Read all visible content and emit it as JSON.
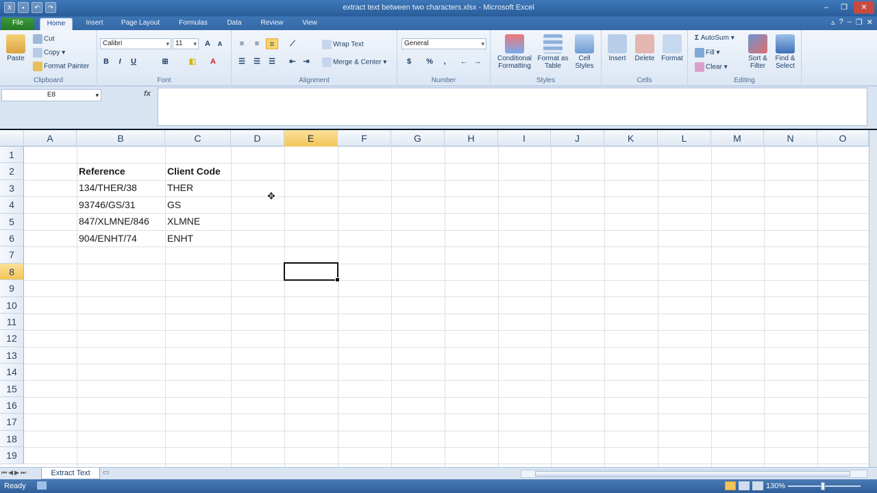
{
  "window": {
    "title": "extract text between two characters.xlsx - Microsoft Excel"
  },
  "tabs": [
    "File",
    "Home",
    "Insert",
    "Page Layout",
    "Formulas",
    "Data",
    "Review",
    "View"
  ],
  "ribbon": {
    "clipboard": {
      "paste": "Paste",
      "cut": "Cut",
      "copy": "Copy",
      "format_painter": "Format Painter",
      "label": "Clipboard"
    },
    "font": {
      "name": "Calibri",
      "size": "11",
      "label": "Font",
      "bold": "B",
      "italic": "I",
      "underline": "U"
    },
    "alignment": {
      "wrap": "Wrap Text",
      "merge": "Merge & Center",
      "label": "Alignment"
    },
    "number": {
      "format": "General",
      "label": "Number",
      "percent": "%"
    },
    "styles": {
      "conditional": "Conditional Formatting",
      "format_table": "Format as Table",
      "cell_styles": "Cell Styles",
      "label": "Styles"
    },
    "cells": {
      "insert": "Insert",
      "delete": "Delete",
      "format": "Format",
      "label": "Cells"
    },
    "editing": {
      "autosum": "AutoSum",
      "fill": "Fill",
      "clear": "Clear",
      "sort": "Sort & Filter",
      "find": "Find & Select",
      "label": "Editing"
    }
  },
  "formula_bar": {
    "name_box": "E8",
    "fx": "fx",
    "value": ""
  },
  "columns": [
    "A",
    "B",
    "C",
    "D",
    "E",
    "F",
    "G",
    "H",
    "I",
    "J",
    "K",
    "L",
    "M",
    "N",
    "O"
  ],
  "rows": [
    "1",
    "2",
    "3",
    "4",
    "5",
    "6",
    "7",
    "8",
    "9",
    "10",
    "11",
    "12",
    "13",
    "14",
    "15",
    "16",
    "17",
    "18",
    "19"
  ],
  "table": {
    "headers": [
      "Reference",
      "Client Code"
    ],
    "rows": [
      [
        "134/THER/38",
        "THER"
      ],
      [
        "93746/GS/31",
        "GS"
      ],
      [
        "847/XLMNE/846",
        "XLMNE"
      ],
      [
        "904/ENHT/74",
        "ENHT"
      ]
    ]
  },
  "sheet": {
    "tab": "Extract Text"
  },
  "status": {
    "text": "Ready",
    "zoom": "130%"
  },
  "colors": {
    "accent": "#2a5d9a",
    "selection_header": "#f3c457"
  }
}
